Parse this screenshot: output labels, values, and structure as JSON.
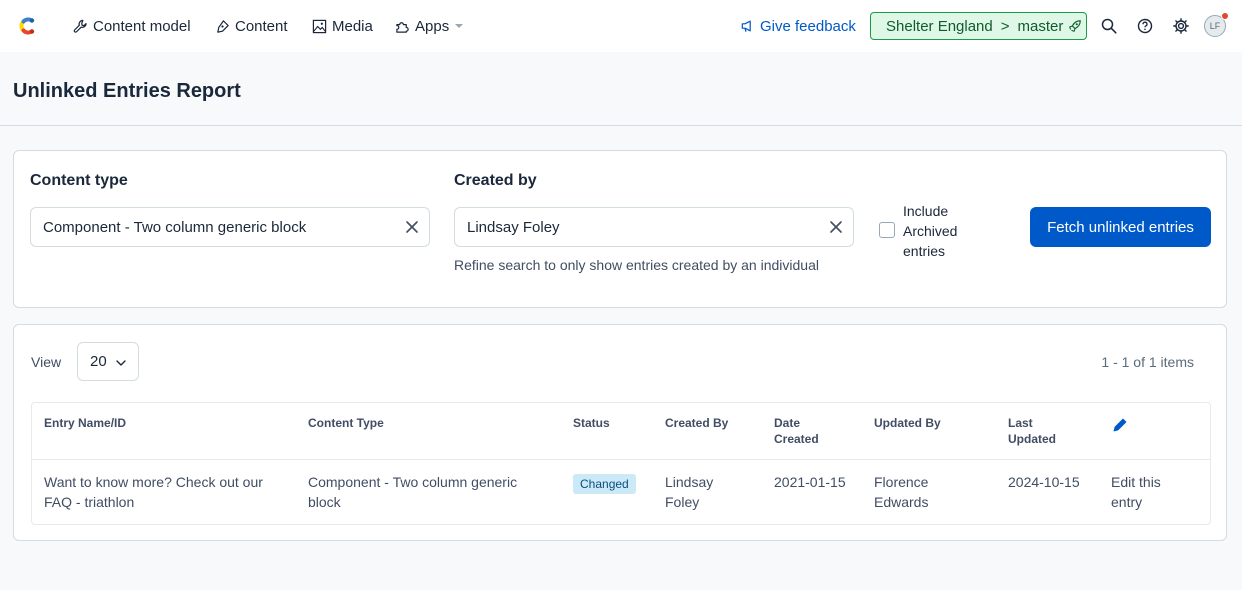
{
  "nav": {
    "items": [
      {
        "label": "Content model",
        "icon": "wrench-icon"
      },
      {
        "label": "Content",
        "icon": "pen-nib-icon"
      },
      {
        "label": "Media",
        "icon": "image-icon"
      },
      {
        "label": "Apps",
        "icon": "puzzle-icon"
      }
    ],
    "feedback_label": "Give feedback",
    "env": {
      "space": "Shelter England",
      "separator": ">",
      "branch": "master"
    },
    "avatar_initials": "LF"
  },
  "page": {
    "title": "Unlinked Entries Report"
  },
  "filters": {
    "content_type": {
      "label": "Content type",
      "value": "Component - Two column generic block"
    },
    "created_by": {
      "label": "Created by",
      "value": "Lindsay Foley",
      "help": "Refine search to only show entries created by an individual"
    },
    "archived": {
      "label": "Include Archived entries",
      "checked": false
    },
    "fetch_label": "Fetch unlinked entries"
  },
  "results": {
    "view_label": "View",
    "page_size": "20",
    "pager_text": "1 - 1 of 1 items",
    "columns": [
      "Entry Name/ID",
      "Content Type",
      "Status",
      "Created By",
      "Date Created",
      "Updated By",
      "Last Updated"
    ],
    "rows": [
      {
        "entry_name": "Want to know more? Check out our FAQ - triathlon",
        "content_type": "Component - Two column generic block",
        "status": "Changed",
        "created_by": "Lindsay Foley",
        "date_created": "2021-01-15",
        "updated_by": "Florence Edwards",
        "last_updated": "2024-10-15",
        "action": "Edit this entry"
      }
    ]
  },
  "colors": {
    "primary": "#0059c8",
    "env_bg": "#dff7e6",
    "env_border": "#1a9a4a",
    "badge_bg": "#cce9f7",
    "notification": "#e0472d"
  }
}
